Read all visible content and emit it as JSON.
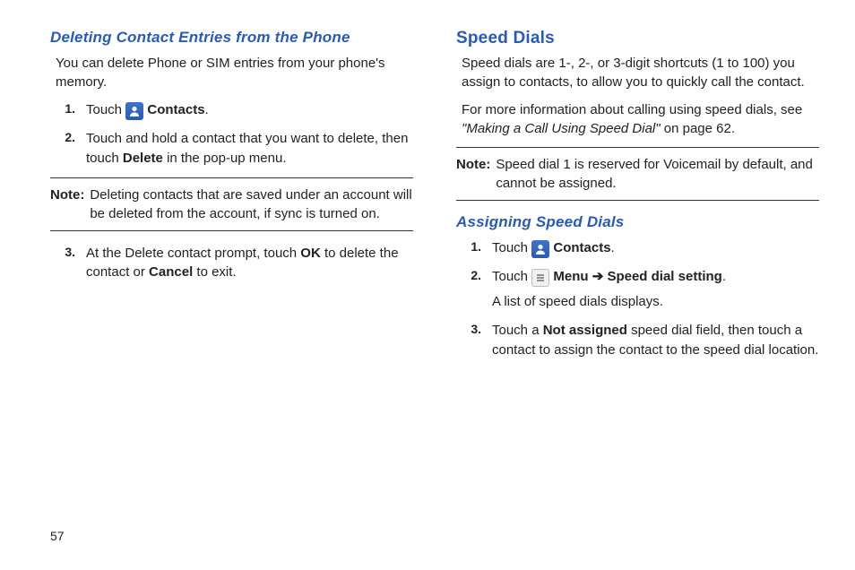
{
  "pageNumber": "57",
  "left": {
    "heading": "Deleting Contact Entries from the Phone",
    "intro": "You can delete Phone or SIM entries from your phone's memory.",
    "steps": {
      "s1_pre": "Touch ",
      "s1_post": " Contacts",
      "s1_suffix": ".",
      "s2_a": "Touch and hold a contact that you want to delete, then touch ",
      "s2_b": "Delete",
      "s2_c": " in the pop-up menu."
    },
    "noteLabel": "Note:",
    "noteText": "Deleting contacts that are saved under an account will be deleted from the account, if sync is turned on.",
    "steps2": {
      "s3_a": "At the Delete contact prompt, touch ",
      "s3_b": "OK",
      "s3_c": " to delete the contact or ",
      "s3_d": "Cancel",
      "s3_e": " to exit."
    }
  },
  "right": {
    "heading": "Speed Dials",
    "p1": "Speed dials are 1-, 2-, or 3-digit shortcuts (1 to 100) you assign to contacts, to allow you to quickly call the contact.",
    "p2_a": "For more information about calling using speed dials, see ",
    "p2_b": "\"Making a Call Using Speed Dial\"",
    "p2_c": " on page 62.",
    "noteLabel": "Note:",
    "noteText": "Speed dial 1 is reserved for Voicemail by default, and cannot be assigned.",
    "subheading": "Assigning Speed Dials",
    "steps": {
      "s1_pre": "Touch ",
      "s1_post": " Contacts",
      "s1_suffix": ".",
      "s2_a": "Touch ",
      "s2_b": " Menu ",
      "s2_arrow": "➔",
      "s2_c": " Speed dial setting",
      "s2_d": ".",
      "s2_sub": "A list of speed dials displays.",
      "s3_a": "Touch a ",
      "s3_b": "Not assigned",
      "s3_c": " speed dial field, then touch a contact to assign the contact to the speed dial location."
    }
  },
  "nums": {
    "n1": "1.",
    "n2": "2.",
    "n3": "3."
  }
}
